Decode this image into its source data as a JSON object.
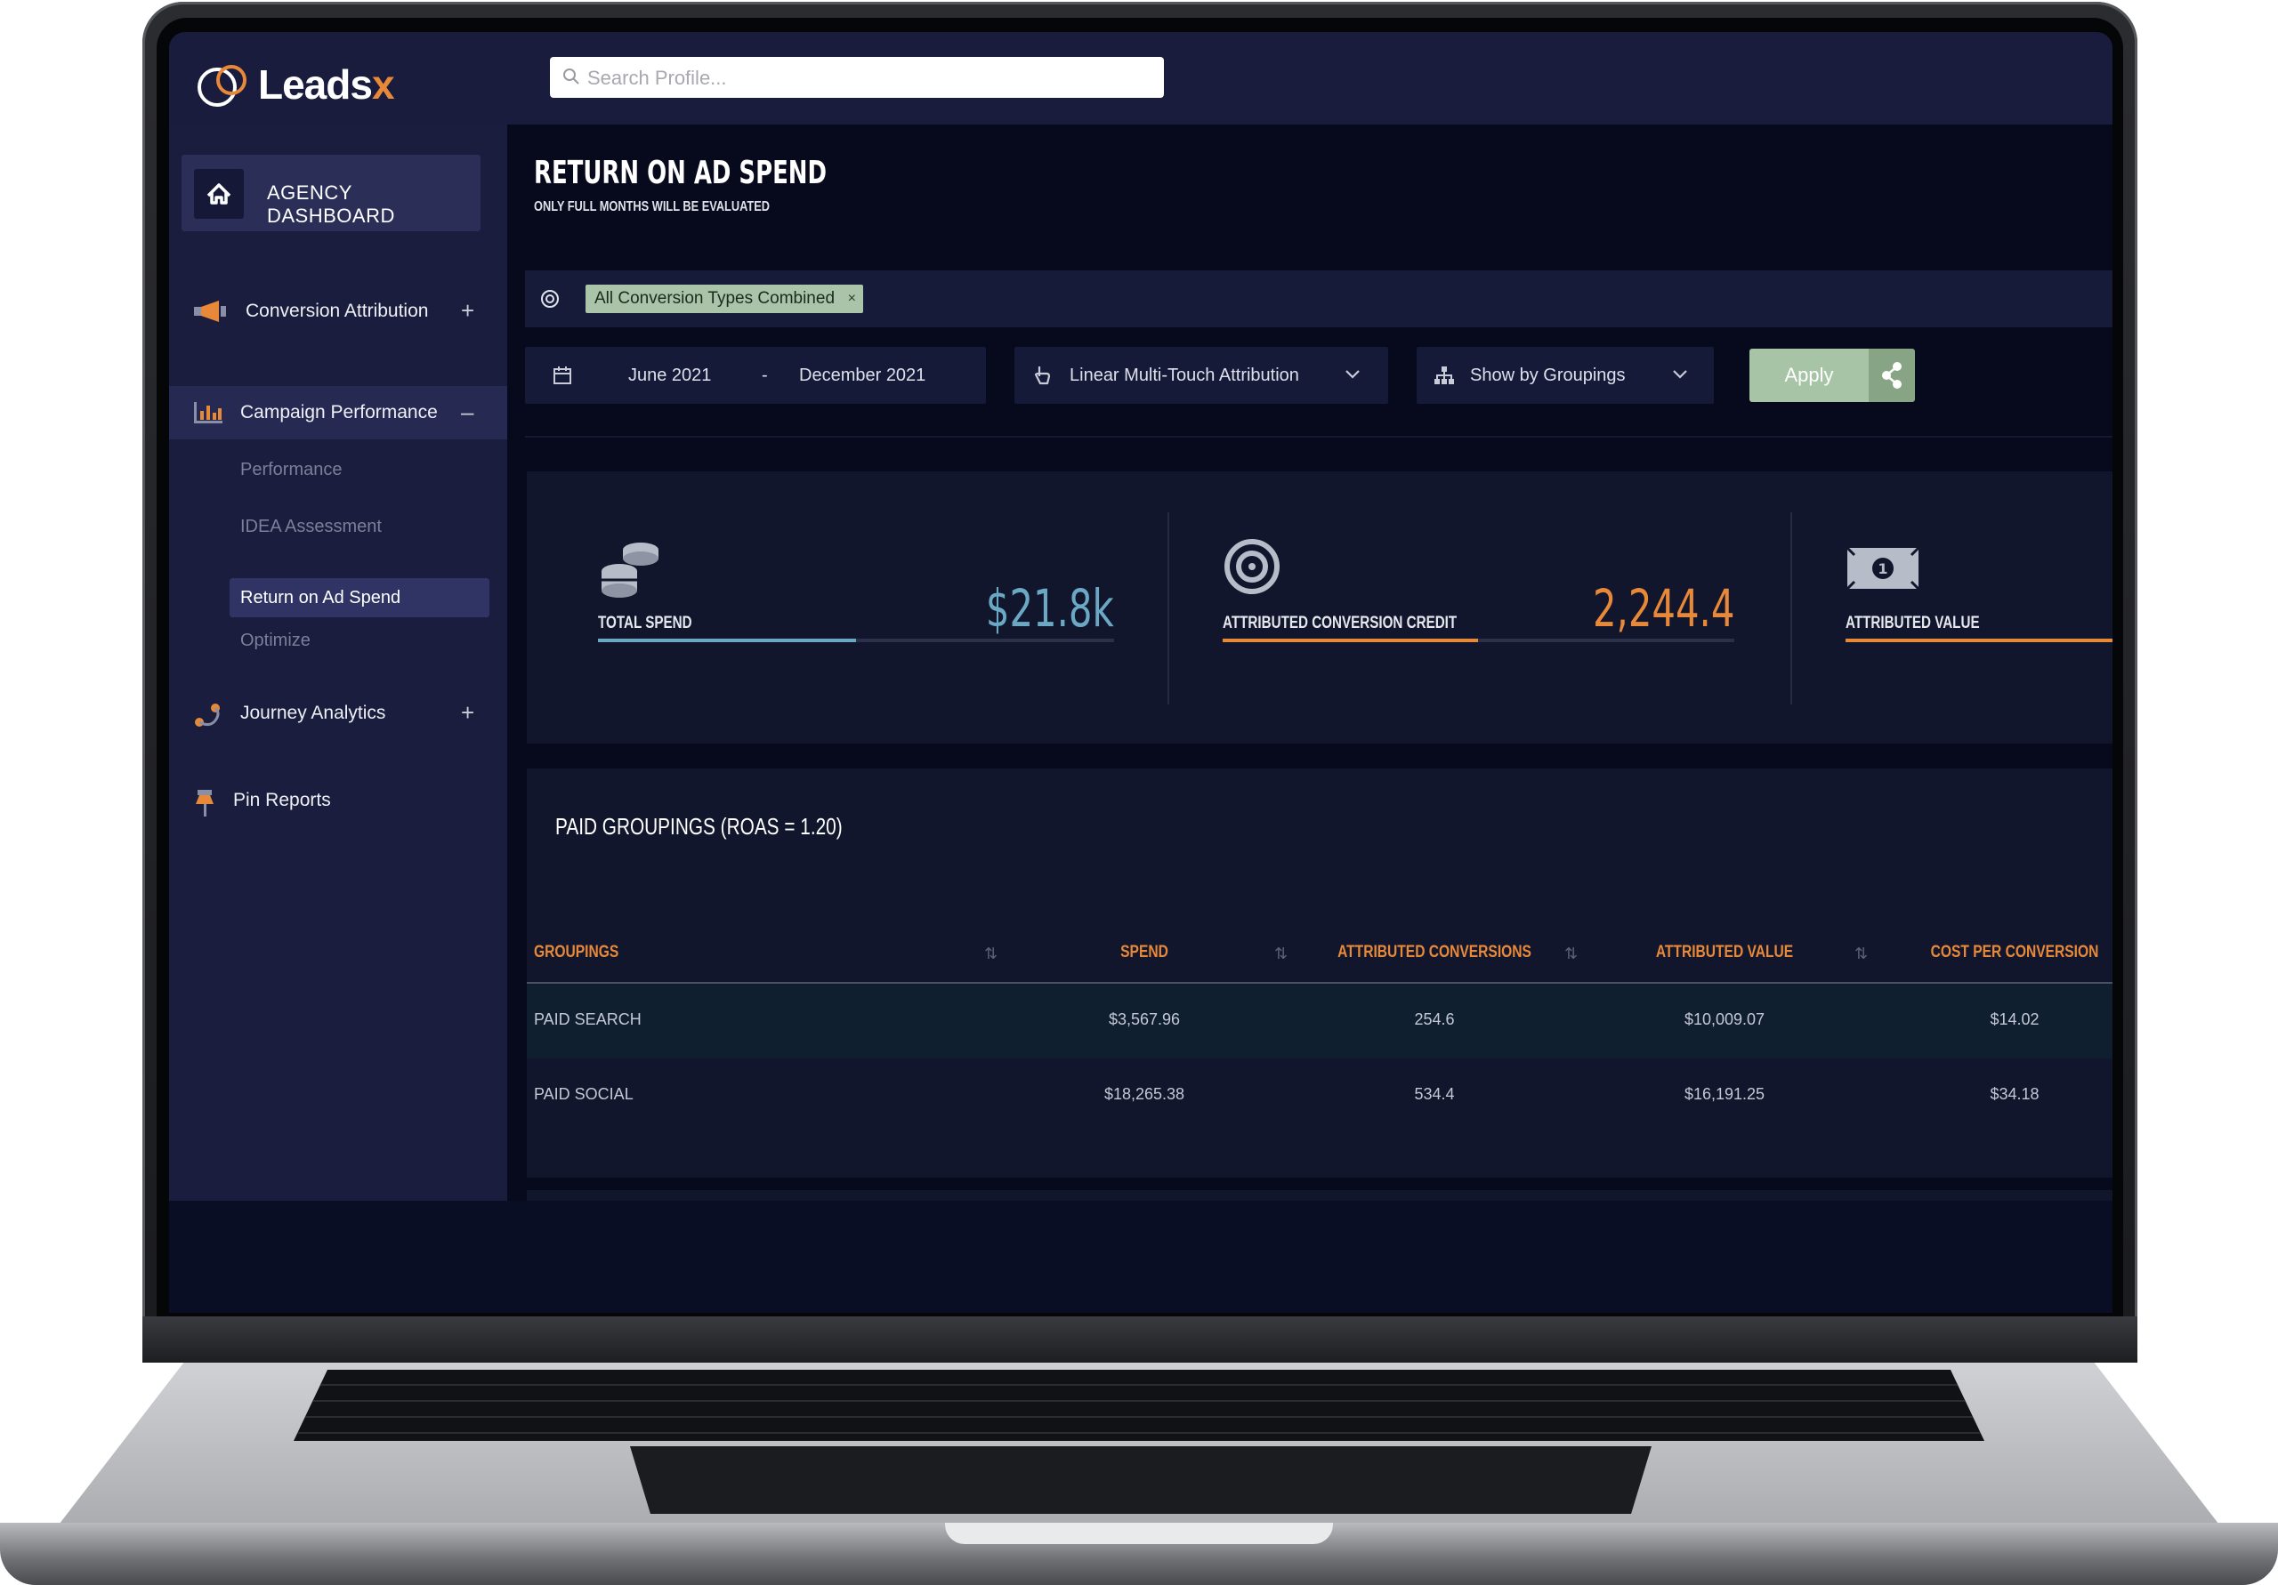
{
  "brand": {
    "name": "Leads",
    "mark": "x",
    "accent": "#e8893a"
  },
  "search": {
    "placeholder": "Search Profile..."
  },
  "sidebar": {
    "home": {
      "label": "AGENCY DASHBOARD",
      "icon": "home-icon"
    },
    "items": [
      {
        "label": "Conversion Attribution",
        "icon": "megaphone-icon",
        "toggle": "+"
      },
      {
        "label": "Campaign Performance",
        "icon": "bar-chart-icon",
        "toggle": "–"
      },
      {
        "label": "Journey Analytics",
        "icon": "route-icon",
        "toggle": "+"
      },
      {
        "label": "Pin Reports",
        "icon": "pin-icon"
      }
    ],
    "sub_items": [
      "Performance",
      "IDEA Assessment",
      "Return on Ad Spend",
      "Optimize"
    ]
  },
  "page": {
    "title": "RETURN ON AD SPEND",
    "subtitle": "ONLY FULL MONTHS WILL BE EVALUATED"
  },
  "filters": {
    "chip": "All Conversion Types Combined",
    "chip_remove": "×",
    "date_start": "June 2021",
    "date_sep": "-",
    "date_end": "December 2021",
    "attribution": "Linear Multi-Touch Attribution",
    "grouping": "Show by Groupings",
    "apply_label": "Apply"
  },
  "metrics": [
    {
      "label": "TOTAL SPEND",
      "value": "$21.8k",
      "color": "#6aa8c4",
      "fill": 0.5,
      "icon": "coins-icon"
    },
    {
      "label": "ATTRIBUTED CONVERSION CREDIT",
      "value": "2,244.4",
      "color": "#e8893a",
      "fill": 0.5,
      "icon": "target-icon"
    },
    {
      "label": "ATTRIBUTED VALUE",
      "value": "",
      "color": "#e8893a",
      "fill": 1.0,
      "icon": "dollar-bill-icon"
    }
  ],
  "table": {
    "title": "PAID GROUPINGS (ROAS = 1.20)",
    "columns": [
      "GROUPINGS",
      "SPEND",
      "ATTRIBUTED CONVERSIONS",
      "ATTRIBUTED VALUE",
      "COST PER CONVERSION"
    ],
    "rows": [
      [
        "PAID SEARCH",
        "$3,567.96",
        "254.6",
        "$10,009.07",
        "$14.02"
      ],
      [
        "PAID SOCIAL",
        "$18,265.38",
        "534.4",
        "$16,191.25",
        "$34.18"
      ]
    ]
  }
}
